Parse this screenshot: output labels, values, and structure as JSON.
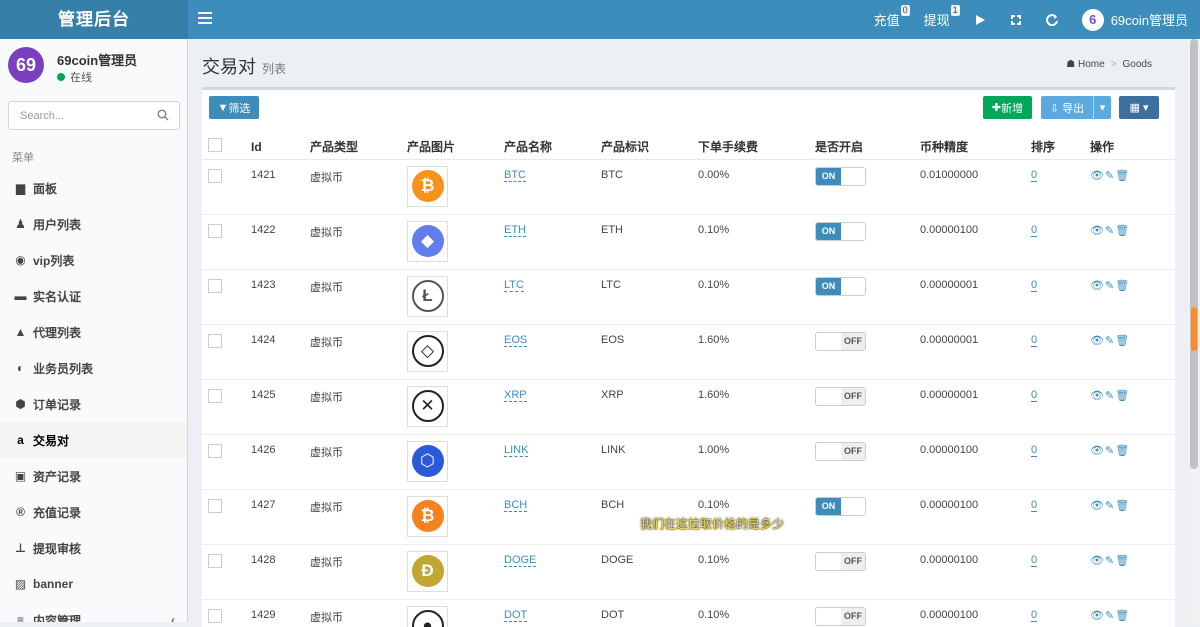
{
  "app": {
    "title": "管理后台"
  },
  "topnav": {
    "recharge": {
      "label": "充值",
      "badge": "0"
    },
    "withdraw": {
      "label": "提现",
      "badge": "1"
    },
    "user": "69coin管理员"
  },
  "sidebar": {
    "user_name": "69coin管理员",
    "user_status": "在线",
    "search_placeholder": "Search...",
    "menu_header": "菜单",
    "items": [
      {
        "label": "面板",
        "icon": "▆"
      },
      {
        "label": "用户列表",
        "icon": "♟"
      },
      {
        "label": "vip列表",
        "icon": "◉"
      },
      {
        "label": "实名认证",
        "icon": "▬"
      },
      {
        "label": "代理列表",
        "icon": "▲"
      },
      {
        "label": "业务员列表",
        "icon": "◐"
      },
      {
        "label": "订单记录",
        "icon": "⬢"
      },
      {
        "label": "交易对",
        "icon": "a"
      },
      {
        "label": "资产记录",
        "icon": "▣"
      },
      {
        "label": "充值记录",
        "icon": "®"
      },
      {
        "label": "提现审核",
        "icon": "⊥"
      },
      {
        "label": "banner",
        "icon": "▨"
      },
      {
        "label": "内容管理",
        "icon": "≡"
      }
    ]
  },
  "page": {
    "title": "交易对",
    "subtitle": "列表",
    "breadcrumb": [
      "Home",
      "Goods"
    ]
  },
  "toolbar": {
    "filter": "筛选",
    "add": "新增",
    "export": "导出"
  },
  "table": {
    "headers": [
      "Id",
      "产品类型",
      "产品图片",
      "产品名称",
      "产品标识",
      "下单手续费",
      "是否开启",
      "币种精度",
      "排序",
      "操作"
    ],
    "rows": [
      {
        "id": "1421",
        "type": "虚拟币",
        "name": "BTC",
        "symbol": "BTC",
        "fee": "0.00%",
        "enabled": "ON",
        "precision": "0.01000000",
        "sort": "0",
        "color": "#f7931a",
        "glyph": "₿"
      },
      {
        "id": "1422",
        "type": "虚拟币",
        "name": "ETH",
        "symbol": "ETH",
        "fee": "0.10%",
        "enabled": "ON",
        "precision": "0.00000100",
        "sort": "0",
        "color": "#627eea",
        "glyph": "◆"
      },
      {
        "id": "1423",
        "type": "虚拟币",
        "name": "LTC",
        "symbol": "LTC",
        "fee": "0.10%",
        "enabled": "ON",
        "precision": "0.00000001",
        "sort": "0",
        "color": "#555555",
        "glyph": "Ł"
      },
      {
        "id": "1424",
        "type": "虚拟币",
        "name": "EOS",
        "symbol": "EOS",
        "fee": "1.60%",
        "enabled": "OFF",
        "precision": "0.00000001",
        "sort": "0",
        "color": "#222222",
        "glyph": "◇"
      },
      {
        "id": "1425",
        "type": "虚拟币",
        "name": "XRP",
        "symbol": "XRP",
        "fee": "1.60%",
        "enabled": "OFF",
        "precision": "0.00000001",
        "sort": "0",
        "color": "#222222",
        "glyph": "✕"
      },
      {
        "id": "1426",
        "type": "虚拟币",
        "name": "LINK",
        "symbol": "LINK",
        "fee": "1.00%",
        "enabled": "OFF",
        "precision": "0.00000100",
        "sort": "0",
        "color": "#2a5ada",
        "glyph": "⬡"
      },
      {
        "id": "1427",
        "type": "虚拟币",
        "name": "BCH",
        "symbol": "BCH",
        "fee": "0.10%",
        "enabled": "ON",
        "precision": "0.00000100",
        "sort": "0",
        "color": "#f58220",
        "glyph": "₿"
      },
      {
        "id": "1428",
        "type": "虚拟币",
        "name": "DOGE",
        "symbol": "DOGE",
        "fee": "0.10%",
        "enabled": "OFF",
        "precision": "0.00000100",
        "sort": "0",
        "color": "#c2a633",
        "glyph": "Ð"
      },
      {
        "id": "1429",
        "type": "虚拟币",
        "name": "DOT",
        "symbol": "DOT",
        "fee": "0.10%",
        "enabled": "OFF",
        "precision": "0.00000100",
        "sort": "0",
        "color": "#222222",
        "glyph": "●"
      }
    ]
  },
  "overlay_text": "我们在这拉取价格的是多少"
}
